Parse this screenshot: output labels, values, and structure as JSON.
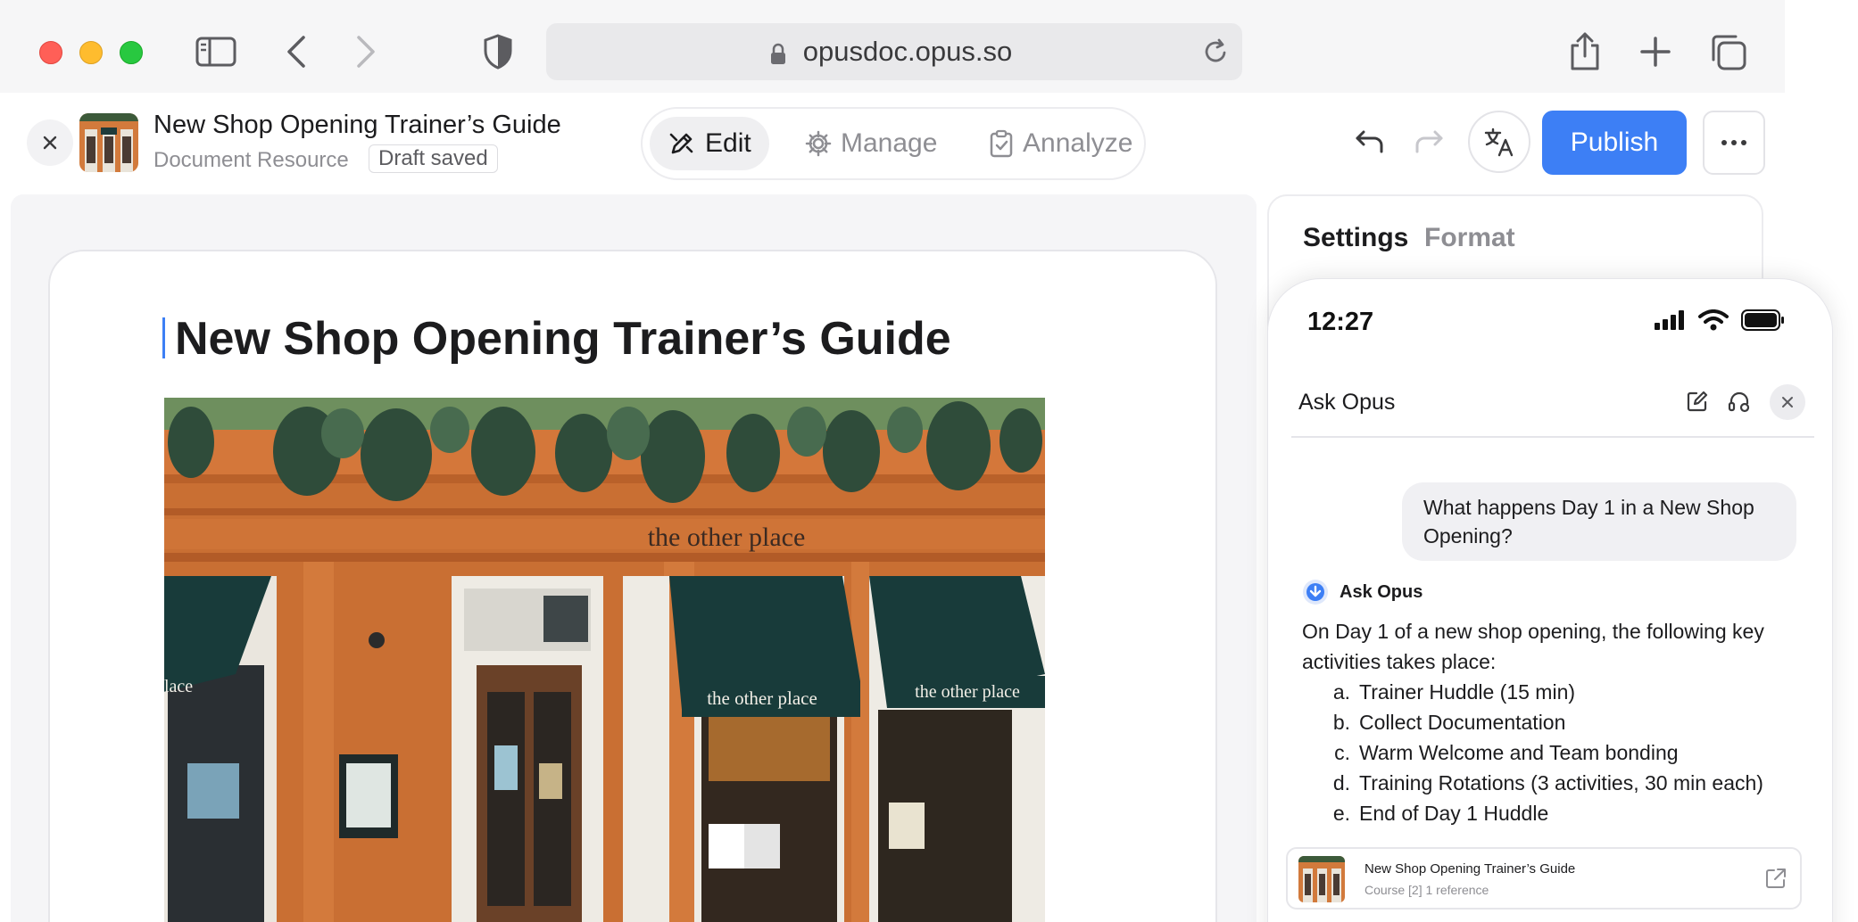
{
  "browser": {
    "url": "opusdoc.opus.so"
  },
  "header": {
    "title": "New Shop Opening Trainer’s Guide",
    "subtitle": "Document Resource",
    "status": "Draft saved",
    "modes": [
      {
        "label": "Edit",
        "icon": "edit-icon"
      },
      {
        "label": "Manage",
        "icon": "gear-icon"
      },
      {
        "label": "Annalyze",
        "icon": "clipboard-icon"
      }
    ],
    "publish_label": "Publish",
    "accent_color": "#3d7ff5"
  },
  "document": {
    "heading": "New Shop Opening Trainer’s Guide",
    "image_sign": "the other place",
    "awning_sign_1": "the other place",
    "awning_sign_2": "the other place",
    "awning_sign_left": "lace"
  },
  "panel": {
    "tabs": [
      "Settings",
      "Format"
    ]
  },
  "phone": {
    "time": "12:27",
    "chat_title": "Ask Opus",
    "question": "What happens Day 1 in a New Shop Opening?",
    "assistant_name": "Ask Opus",
    "answer_intro": "On Day 1 of a new shop opening, the following key activities takes place:",
    "answer_items": [
      {
        "marker": "a.",
        "text": "Trainer Huddle (15 min)"
      },
      {
        "marker": "b.",
        "text": "Collect Documentation"
      },
      {
        "marker": "c.",
        "text": "Warm Welcome and Team bonding"
      },
      {
        "marker": "d.",
        "text": "Training Rotations (3 activities, 30 min each)"
      },
      {
        "marker": "e.",
        "text": "End of Day 1 Huddle"
      }
    ],
    "reference": {
      "title": "New Shop Opening Trainer’s Guide",
      "meta": "Course [2] 1 reference"
    }
  }
}
